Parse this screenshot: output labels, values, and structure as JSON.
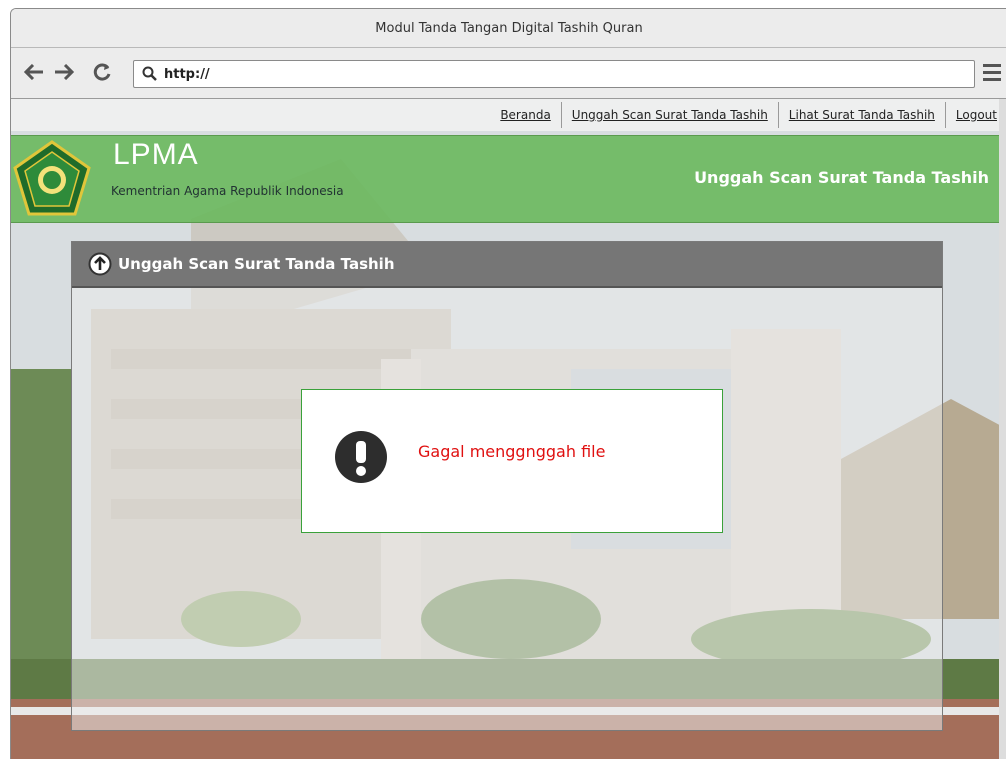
{
  "window": {
    "title": "Modul Tanda Tangan Digital Tashih Quran"
  },
  "browser": {
    "url": "http://"
  },
  "nav": {
    "links": [
      "Beranda",
      "Unggah Scan Surat Tanda Tashih",
      "Lihat Surat Tanda Tashih",
      "Logout"
    ]
  },
  "header": {
    "brand": "LPMA",
    "subtitle": "Kementrian Agama Republik Indonesia",
    "page_title": "Unggah Scan Surat Tanda Tashih",
    "color": "#6cb95f"
  },
  "panel": {
    "title": "Unggah Scan Surat Tanda Tashih"
  },
  "alert": {
    "message": "Gagal menggnggah file",
    "color": "#e01010"
  }
}
